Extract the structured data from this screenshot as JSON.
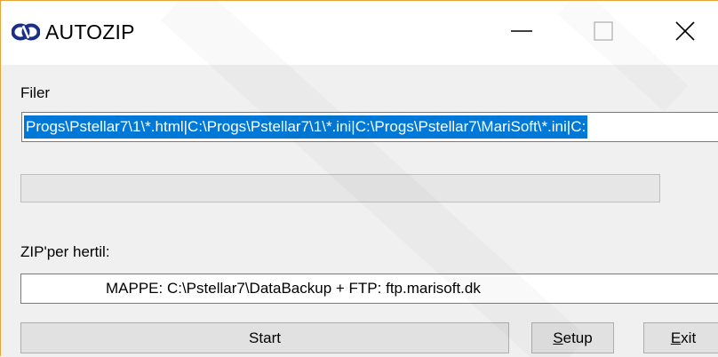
{
  "window": {
    "title": "AUTOZIP",
    "controls": {
      "minimize": "minimize",
      "maximize": "maximize",
      "close": "close"
    }
  },
  "files": {
    "label": "Filer",
    "value": "Progs\\Pstellar7\\1\\*.html|C:\\Progs\\Pstellar7\\1\\*.ini|C:\\Progs\\Pstellar7\\MariSoft\\*.ini|C:"
  },
  "progress": {
    "value": 0
  },
  "destination": {
    "label": "ZIP'per  hertil:",
    "value": "MAPPE: C:\\Pstellar7\\DataBackup + FTP: ftp.marisoft.dk"
  },
  "buttons": {
    "start": "Start",
    "setup_mnemonic": "S",
    "setup_rest": "etup",
    "exit_mnemonic": "E",
    "exit_rest": "xit"
  },
  "colors": {
    "selection": "#0078d7",
    "window_border": "#e8a33d",
    "progress_fill": "#06b025"
  },
  "icons": {
    "app": "autozip-logo-icon",
    "minimize": "minimize-icon",
    "maximize": "maximize-icon",
    "close": "close-icon"
  }
}
